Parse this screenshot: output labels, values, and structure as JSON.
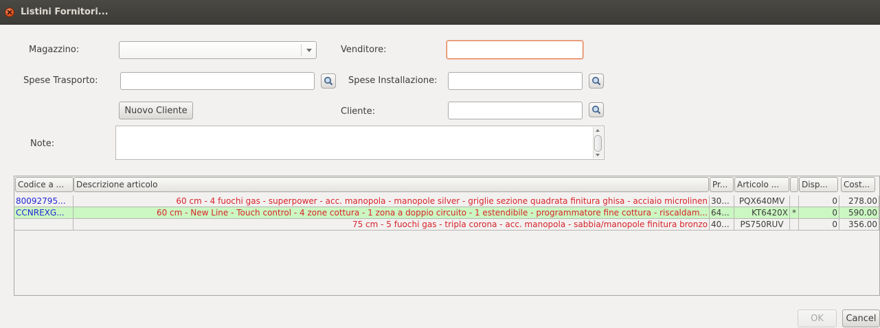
{
  "window": {
    "title": "Listini Fornitori..."
  },
  "form": {
    "magazzino_label": "Magazzino:",
    "magazzino_value": "",
    "venditore_label": "Venditore:",
    "venditore_value": "",
    "spese_trasporto_label": "Spese Trasporto:",
    "spese_trasporto_value": "",
    "spese_installazione_label": "Spese Installazione:",
    "spese_installazione_value": "",
    "nuovo_cliente_label": "Nuovo Cliente",
    "cliente_label": "Cliente:",
    "cliente_value": "",
    "note_label": "Note:",
    "note_value": ""
  },
  "table": {
    "columns": [
      "Codice a ...",
      "Descrizione articolo",
      "Pr...",
      "Articolo ...",
      "",
      "Disp...",
      "Cost..."
    ],
    "rows": [
      {
        "codice": "80092795...",
        "descrizione": "60 cm - 4 fuochi gas - superpower - acc. manopola - manopole silver - griglie sezione quadrata finitura ghisa  - acciaio microlinen",
        "pr": "30...",
        "articolo": "PQX640MV",
        "flag": "",
        "disp": "0",
        "costo": "278.00"
      },
      {
        "codice": "CCNREXG...",
        "descrizione": "60 cm - New Line - Touch control - 4 zone cottura - 1 zona a doppio circuito - 1 estendibile - programmatore fine cottura - riscaldam...",
        "pr": "64...",
        "articolo": "KT6420X",
        "flag": "*",
        "disp": "0",
        "costo": "590.00"
      },
      {
        "codice": "",
        "descrizione": "75 cm - 5 fuochi gas  - tripla corona - acc. manopola - sabbia/manopole finitura bronzo",
        "pr": "40...",
        "articolo": "PS750RUV",
        "flag": "",
        "disp": "0",
        "costo": "356.00"
      }
    ]
  },
  "buttons": {
    "ok_label": "OK",
    "cancel_label": "Cancel"
  },
  "colors": {
    "code_text": "#2227d6",
    "description_text": "#d8232a",
    "selected_row": "#cbf7c2",
    "focus_border": "#e07a4f"
  }
}
